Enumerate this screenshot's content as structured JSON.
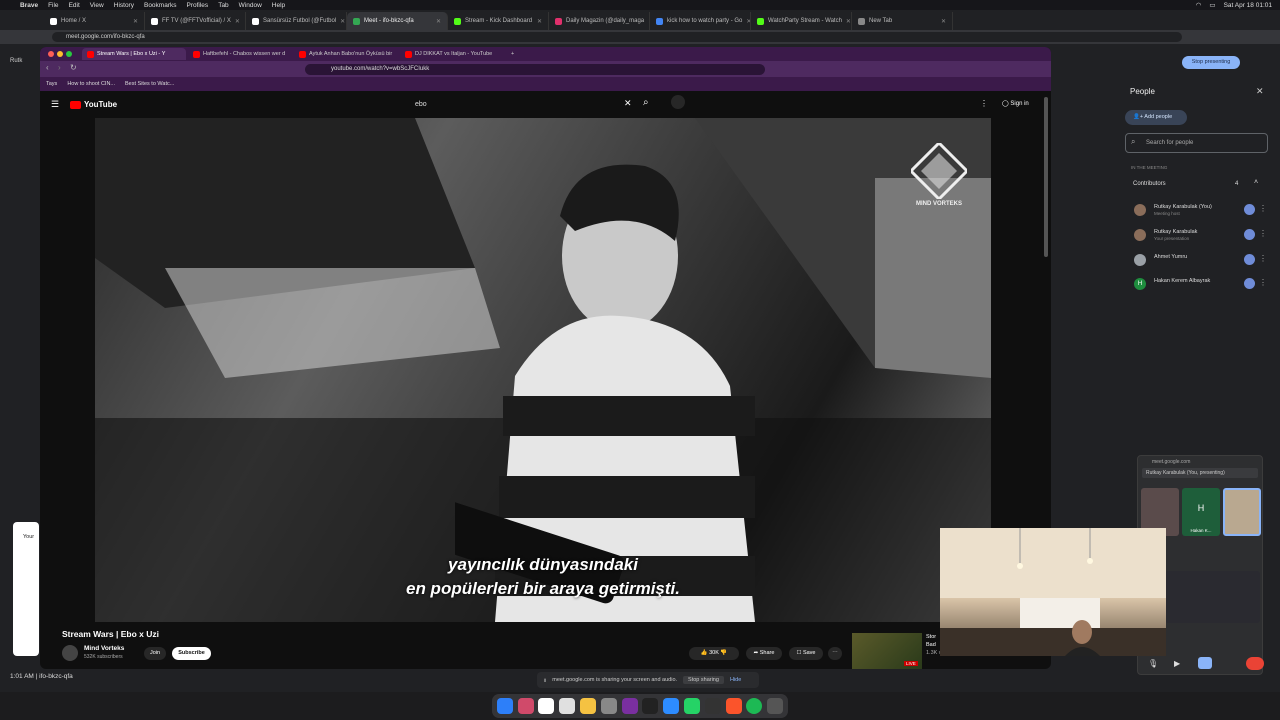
{
  "menubar": {
    "app": "Brave",
    "items": [
      "File",
      "Edit",
      "View",
      "History",
      "Bookmarks",
      "Profiles",
      "Tab",
      "Window",
      "Help"
    ],
    "datetime": "Sat Apr 18  01:01"
  },
  "outer_tabs": [
    {
      "label": "Home / X",
      "color": "#ffffff"
    },
    {
      "label": "FF TV (@FFTVofficial) / X",
      "color": "#ffffff"
    },
    {
      "label": "Sansürsüz Futbol (@Futbol",
      "color": "#ffffff"
    },
    {
      "label": "Meet - ifo-bkzc-qfa",
      "color": "#34a853",
      "active": true
    },
    {
      "label": "Stream - Kick Dashboard",
      "color": "#53fc18"
    },
    {
      "label": "Daily Magazin (@daily_maga",
      "color": "#e1306c"
    },
    {
      "label": "kick how to watch party - Go",
      "color": "#4285f4"
    },
    {
      "label": "WatchParty Stream - Watch",
      "color": "#53fc18"
    },
    {
      "label": "New Tab",
      "color": "#888888"
    }
  ],
  "outer_url": "meet.google.com/ifo-bkzc-qfa",
  "stop_presenting": "Stop presenting",
  "inner_tabs": [
    {
      "label": "Stream Wars | Ebo x Uzi - Y",
      "active": true
    },
    {
      "label": "Haftbefehl - Chabos wissen wer d"
    },
    {
      "label": "Aytuk Anhan Babo'nun Öyküsü bir"
    },
    {
      "label": "DJ DIKKAT vs Italjan - YouTube"
    }
  ],
  "inner_url": "youtube.com/watch?v=wbScJFCIukk",
  "bookmarks": [
    "Tays",
    "How to shoot CIN...",
    "Best Sites to Watc..."
  ],
  "youtube": {
    "logo": "YouTube",
    "search_value": "ebo",
    "sign_in": "Sign in"
  },
  "video": {
    "subtitle_line1": "yayıncılık dünyasındaki",
    "subtitle_line2": "en popülerleri bir araya getirmişti.",
    "watermark": "MIND VORTEKS"
  },
  "video_title": "Stream Wars | Ebo x Uzi",
  "channel": {
    "name": "Mind Vorteks",
    "subs": "532K subscribers",
    "join": "Join",
    "subscribe": "Subscribe"
  },
  "actions": {
    "likes": "30K",
    "share": "Share",
    "save": "Save"
  },
  "related": {
    "title": "Stor",
    "sub": "Bad",
    "badge": "LIVE",
    "watching": "1.3K watching"
  },
  "people_panel": {
    "title": "People",
    "add_people": "Add people",
    "search_placeholder": "Search for people",
    "section": "IN THE MEETING",
    "contributors_label": "Contributors",
    "contributors_count": "4",
    "members": [
      {
        "name": "Rutkay Karabulak (You)",
        "sub": "Meeting host",
        "color": "#8a6d5a"
      },
      {
        "name": "Rutkay Karabulak",
        "sub": "Your presentation",
        "color": "#8a6d5a"
      },
      {
        "name": "Ahmet Yumru",
        "sub": "",
        "color": "#9aa0a6"
      },
      {
        "name": "Hakan Kerem Albayrak",
        "sub": "",
        "color": "#1e8e3e",
        "initial": "H"
      }
    ]
  },
  "pip": {
    "url": "meet.google.com",
    "presenting": "Rutkay Karabulak (You, presenting)",
    "tile_initial": "H",
    "tile_name": "Hakan K..."
  },
  "share_bar": {
    "text": "meet.google.com is sharing your screen and audio.",
    "stop": "Stop sharing",
    "hide": "Hide"
  },
  "bottom": {
    "time": "1:01 AM",
    "code": "ifo-bkzc-qfa"
  },
  "meet_left": {
    "label": "Rutk",
    "card_title": "Your"
  }
}
